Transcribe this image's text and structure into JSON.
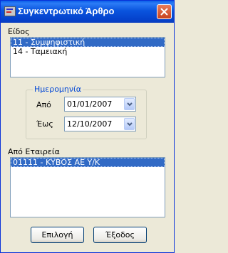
{
  "window": {
    "title": "Συγκεντρωτικό Άρθρο"
  },
  "type_section": {
    "label": "Είδος",
    "items": [
      {
        "label": "11 - Συμψηφιστική",
        "selected": true
      },
      {
        "label": "14 - Ταμειακή",
        "selected": false
      }
    ]
  },
  "date_group": {
    "legend": "Ημερομηνία",
    "from_label": "Από",
    "from_value": "01/01/2007",
    "to_label": "Έως",
    "to_value": "12/10/2007"
  },
  "company_section": {
    "label": "Από Εταιρεία",
    "items": [
      {
        "label": "01111 - ΚΥΒΟΣ ΑΕ Υ/Κ",
        "selected": true
      }
    ]
  },
  "buttons": {
    "select": "Επιλογή",
    "exit": "Έξοδος"
  },
  "colors": {
    "title_bar": "#0a54de",
    "selection": "#316ac5",
    "group_legend": "#0046d5",
    "window_bg": "#ece9d8"
  },
  "icons": {
    "app": "app-window-icon",
    "close": "close-icon",
    "dropdown": "chevron-down-icon"
  }
}
